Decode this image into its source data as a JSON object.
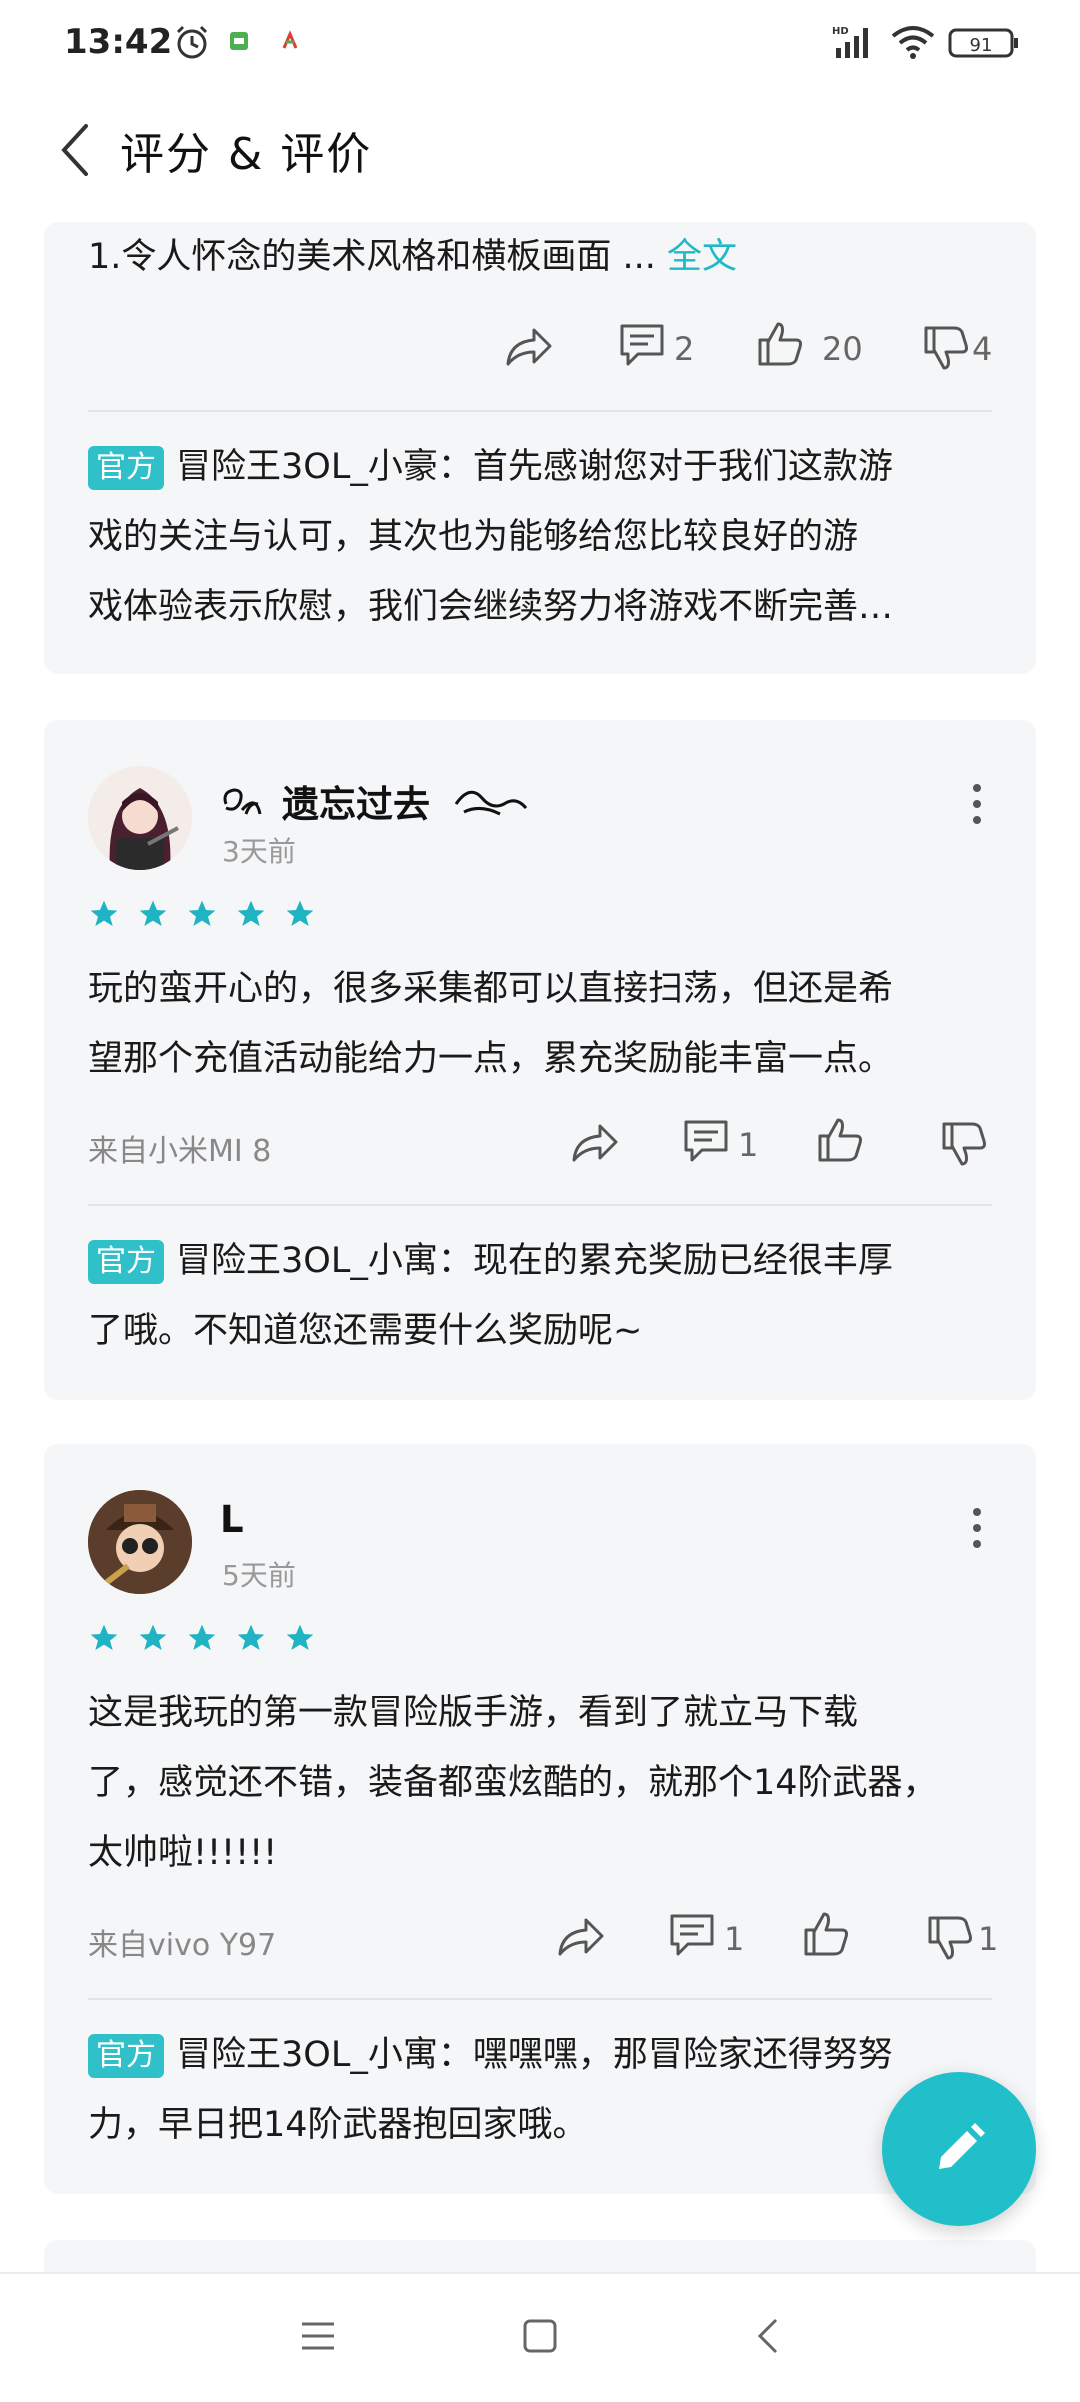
{
  "status_bar": {
    "time": "13:42",
    "battery": "91",
    "network": "HD"
  },
  "header": {
    "title": "评分 & 评价"
  },
  "review1": {
    "text": "1.令人怀念的美术风格和横板画面 ...",
    "more_label": "全文",
    "comments": "2",
    "likes": "20",
    "dislikes": "4",
    "reply": {
      "tag": "官方",
      "lines": [
        "冒险王3OL_小豪：首先感谢您对于我们这款游",
        "戏的关注与认可，其次也为能够给您比较良好的游",
        "戏体验表示欣慰，我们会继续努力将游戏不断完善…"
      ]
    }
  },
  "review2": {
    "name": "遗忘过去",
    "date": "3天前",
    "rating": 5,
    "lines": [
      "玩的蛮开心的，很多采集都可以直接扫荡，但还是希",
      "望那个充值活动能给力一点，累充奖励能丰富一点。"
    ],
    "source": "来自小米MI 8",
    "comments": "1",
    "reply": {
      "tag": "官方",
      "lines": [
        "冒险王3OL_小寓：现在的累充奖励已经很丰厚",
        "了哦。不知道您还需要什么奖励呢~"
      ]
    }
  },
  "review3": {
    "name": "L",
    "date": "5天前",
    "rating": 5,
    "lines": [
      "这是我玩的第一款冒险版手游，看到了就立马下载",
      "了，感觉还不错，装备都蛮炫酷的，就那个14阶武器，",
      "太帅啦!!!!!!"
    ],
    "source": "来自vivo Y97",
    "comments": "1",
    "dislikes": "1",
    "reply": {
      "tag": "官方",
      "lines": [
        "冒险王3OL_小寓：嘿嘿嘿，那冒险家还得努努",
        "力，早日把14阶武器抱回家哦。"
      ]
    }
  },
  "colors": {
    "accent": "#20bfc9",
    "card_bg": "#f5f6f8",
    "star": "#1fb3c3"
  }
}
